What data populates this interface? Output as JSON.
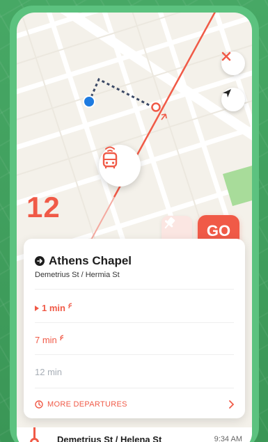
{
  "route": {
    "number": "12"
  },
  "actions": {
    "go_label": "GO"
  },
  "stop": {
    "name": "Athens Chapel",
    "cross_street": "Demetrius St / Hermia St"
  },
  "departures": [
    {
      "label": "1 min",
      "realtime": true,
      "highlight": true
    },
    {
      "label": "7 min",
      "realtime": true,
      "highlight": false
    },
    {
      "label": "12 min",
      "realtime": false,
      "highlight": false
    }
  ],
  "more_departures_label": "MORE DEPARTURES",
  "next_stop": {
    "name": "Demetrius St / Helena St",
    "time": "9:34 AM"
  },
  "colors": {
    "accent": "#f05a47",
    "background": "#3d9a5a",
    "map": "#f4f1ea",
    "user_location": "#1e7be0",
    "muted": "#a7aeb6"
  },
  "icons": {
    "close": "close-icon",
    "locate": "navigation-arrow-icon",
    "bus": "bus-icon",
    "pin": "pin-icon",
    "stop": "arrow-circle-icon",
    "clock": "clock-icon",
    "chevron": "chevron-right-icon",
    "realtime": "realtime-signal-icon"
  }
}
